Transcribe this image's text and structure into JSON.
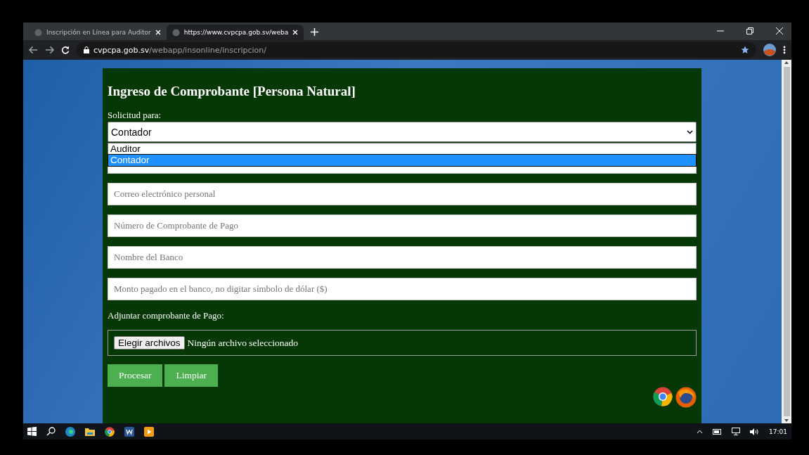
{
  "browser": {
    "tabs": [
      {
        "title": "Inscripción en Línea para Auditor",
        "selected": false
      },
      {
        "title": "https://www.cvpcpa.gob.sv/weba",
        "selected": true
      }
    ],
    "address": {
      "host": "cvpcpa.gob.sv",
      "path": "/webapp/insonline/inscripcion/"
    }
  },
  "form": {
    "title": "Ingreso de Comprobante [Persona Natural]",
    "select_label": "Solicitud para:",
    "select_value": "Contador",
    "options": [
      {
        "label": "Auditor",
        "selected": false
      },
      {
        "label": "Contador",
        "selected": true
      }
    ],
    "covered_field": true,
    "fields": [
      {
        "placeholder": "Correo electrónico personal"
      },
      {
        "placeholder": "Número de Comprobante de Pago"
      },
      {
        "placeholder": "Nombre del Banco"
      },
      {
        "placeholder": "Monto pagado en el banco, no digitar símbolo de dólar ($)"
      }
    ],
    "attach_label": "Adjuntar comprobante de Pago:",
    "file_button": "Elegir archivos",
    "file_status": "Ningún archivo seleccionado",
    "buttons": [
      "Procesar",
      "Limpiar"
    ]
  },
  "taskbar": {
    "time": "17:01"
  }
}
